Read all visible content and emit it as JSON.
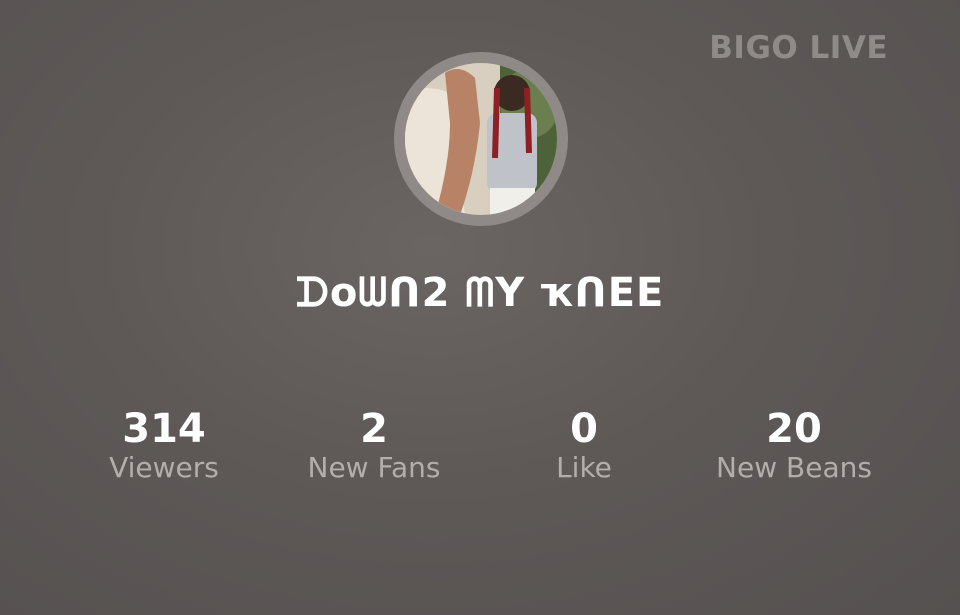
{
  "brand": {
    "label": "BIGO LIVE"
  },
  "profile": {
    "avatar_icon": "profile-photo",
    "title": "ᗪoᗯᑎ2 ᗰY ҡᑎEE"
  },
  "stats": [
    {
      "value": "314",
      "label": "Viewers"
    },
    {
      "value": "2",
      "label": "New Fans"
    },
    {
      "value": "0",
      "label": "Like"
    },
    {
      "value": "20",
      "label": "New Beans"
    }
  ],
  "colors": {
    "background": "#5e5957",
    "avatar_ring": "#8f8a88",
    "label_gray": "#b3aeab",
    "brand_gray": "#8f8b89"
  }
}
